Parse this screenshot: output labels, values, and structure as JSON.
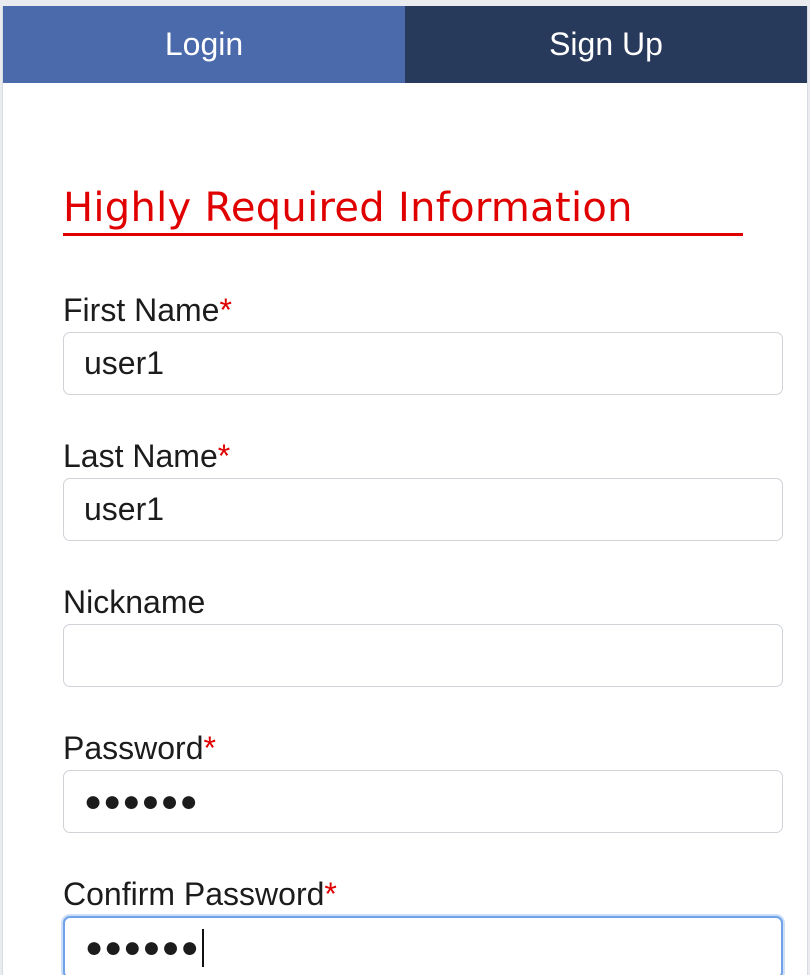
{
  "tabs": {
    "login": "Login",
    "signup": "Sign Up"
  },
  "section_title": "Highly Required Information",
  "required_marker": "*",
  "fields": {
    "first_name": {
      "label": "First Name",
      "value": "user1"
    },
    "last_name": {
      "label": "Last Name",
      "value": "user1"
    },
    "nickname": {
      "label": "Nickname",
      "value": ""
    },
    "password": {
      "label": "Password",
      "value": "●●●●●●"
    },
    "confirm_password": {
      "label": "Confirm Password",
      "value": "●●●●●●"
    }
  },
  "colors": {
    "tab_login": "#4a6aac",
    "tab_signup": "#283a5c",
    "required": "#e00000",
    "focus_border": "#6fa2e8"
  }
}
